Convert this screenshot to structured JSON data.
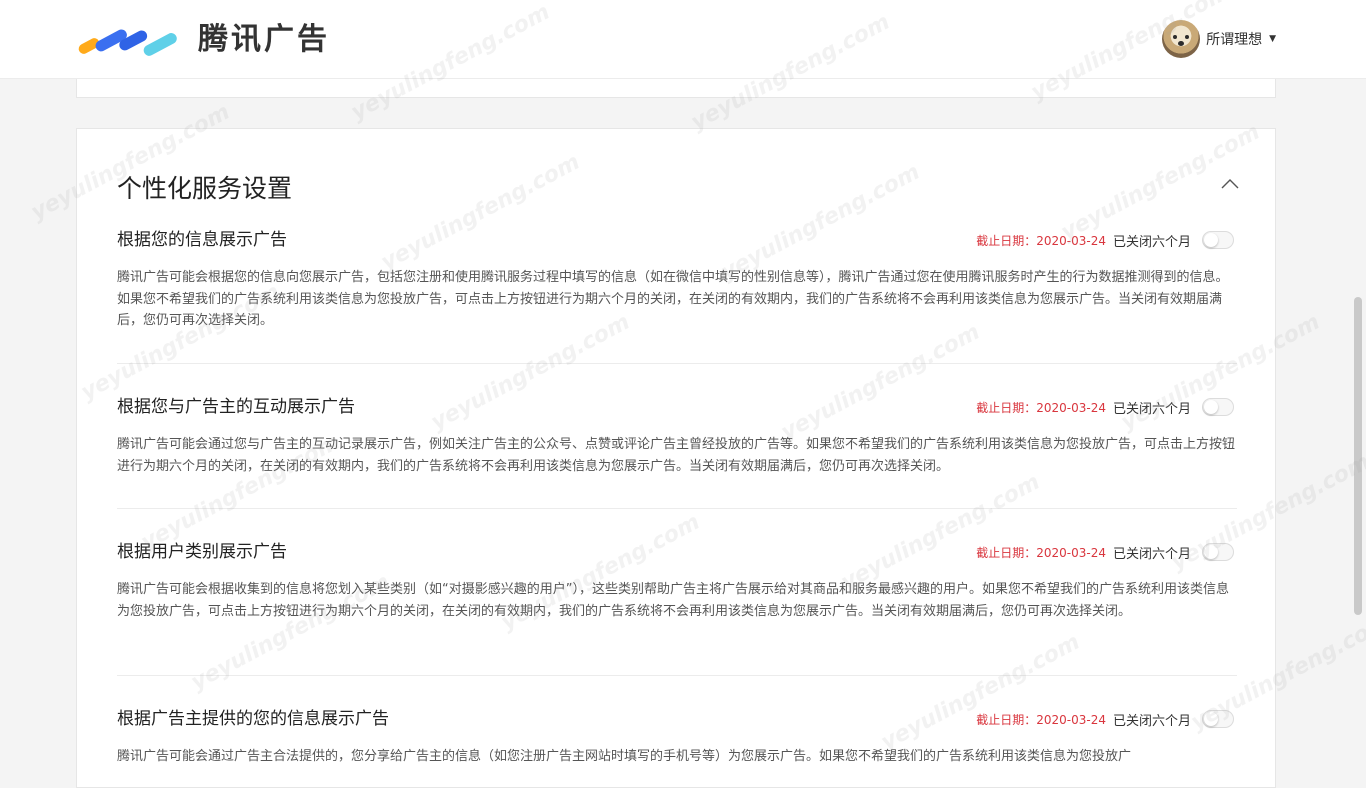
{
  "header": {
    "logo_text": "腾讯广告",
    "user_name": "所谓理想"
  },
  "card": {
    "title": "个性化服务设置",
    "items": [
      {
        "title": "根据您的信息展示广告",
        "deadline": "截止日期：2020-03-24",
        "state": "已关闭六个月",
        "description": "腾讯广告可能会根据您的信息向您展示广告，包括您注册和使用腾讯服务过程中填写的信息（如在微信中填写的性别信息等），腾讯广告通过您在使用腾讯服务时产生的行为数据推测得到的信息。如果您不希望我们的广告系统利用该类信息为您投放广告，可点击上方按钮进行为期六个月的关闭，在关闭的有效期内，我们的广告系统将不会再利用该类信息为您展示广告。当关闭有效期届满后，您仍可再次选择关闭。"
      },
      {
        "title": "根据您与广告主的互动展示广告",
        "deadline": "截止日期：2020-03-24",
        "state": "已关闭六个月",
        "description": "腾讯广告可能会通过您与广告主的互动记录展示广告，例如关注广告主的公众号、点赞或评论广告主曾经投放的广告等。如果您不希望我们的广告系统利用该类信息为您投放广告，可点击上方按钮进行为期六个月的关闭，在关闭的有效期内，我们的广告系统将不会再利用该类信息为您展示广告。当关闭有效期届满后，您仍可再次选择关闭。"
      },
      {
        "title": "根据用户类别展示广告",
        "deadline": "截止日期：2020-03-24",
        "state": "已关闭六个月",
        "description": "腾讯广告可能会根据收集到的信息将您划入某些类别（如“对摄影感兴趣的用户”），这些类别帮助广告主将广告展示给对其商品和服务最感兴趣的用户。如果您不希望我们的广告系统利用该类信息为您投放广告，可点击上方按钮进行为期六个月的关闭，在关闭的有效期内，我们的广告系统将不会再利用该类信息为您展示广告。当关闭有效期届满后，您仍可再次选择关闭。"
      },
      {
        "title": "根据广告主提供的您的信息展示广告",
        "deadline": "截止日期：2020-03-24",
        "state": "已关闭六个月",
        "description": "腾讯广告可能会通过广告主合法提供的，您分享给广告主的信息（如您注册广告主网站时填写的手机号等）为您展示广告。如果您不希望我们的广告系统利用该类信息为您投放广"
      }
    ]
  },
  "watermark": "yeyulingfeng.com",
  "colors": {
    "deadline": "#d9363e",
    "logo_blue": "#3a6ff0",
    "logo_orange": "#ffaa1a",
    "logo_teal": "#5fd0e8"
  }
}
